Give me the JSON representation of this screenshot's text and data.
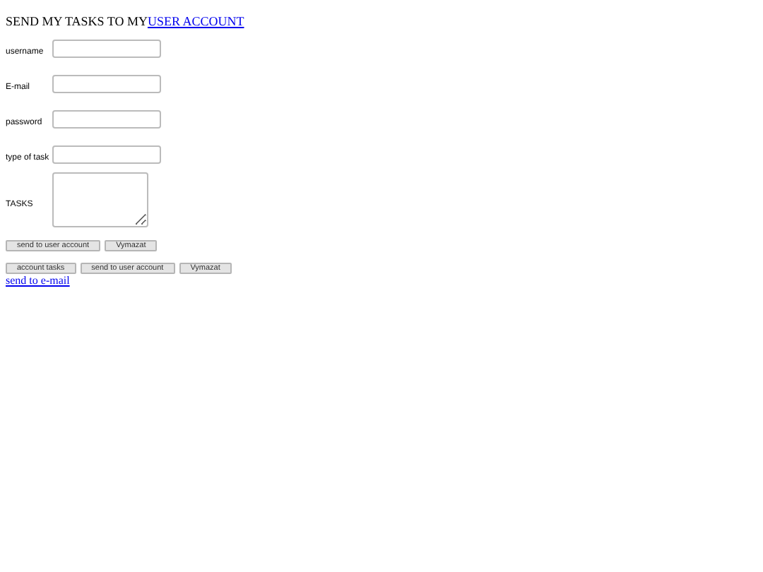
{
  "heading": {
    "text": "SEND MY TASKS TO MY",
    "link": "USER ACCOUNT"
  },
  "fields": [
    {
      "label": "username",
      "kind": "text"
    },
    {
      "label": "E-mail",
      "kind": "text"
    },
    {
      "label": "password",
      "kind": "text"
    },
    {
      "label": "type of task",
      "kind": "text"
    },
    {
      "label": "TASKS",
      "kind": "textarea"
    }
  ],
  "form_buttons": [
    "send to user account",
    "Vymazat"
  ],
  "second_buttons": [
    "account tasks",
    "send to user account",
    "Vymazat"
  ],
  "email_link": "send to e-mail"
}
